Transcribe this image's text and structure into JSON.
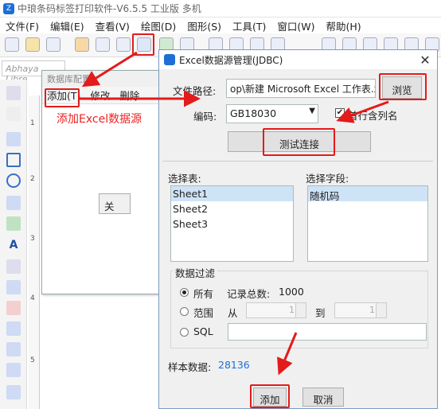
{
  "app": {
    "title": "中琅条码标签打印软件-V6.5.5 工业版 多机",
    "font_name": "Abhaya Libre"
  },
  "menu": [
    "文件(F)",
    "编辑(E)",
    "查看(V)",
    "绘图(D)",
    "图形(S)",
    "工具(T)",
    "窗口(W)",
    "帮助(H)"
  ],
  "ruler": [
    "1",
    "2",
    "3",
    "4",
    "5"
  ],
  "ds_manager": {
    "title": "数据库配置",
    "menu": {
      "add": "添加(T)",
      "edit": "修改",
      "delete": "删除"
    },
    "annotation": "添加Excel数据源",
    "close_label": "关"
  },
  "dialog": {
    "title": "Excel数据源管理(JDBC)",
    "file_path_label": "文件路径:",
    "file_path_value": "op\\新建 Microsoft Excel 工作表.xls",
    "browse": "浏览",
    "encoding_label": "编码:",
    "encoding_value": "GB18030",
    "first_row_label": "首行含列名",
    "test_connection": "测试连接",
    "select_table_label": "选择表:",
    "tables": [
      "Sheet1",
      "Sheet2",
      "Sheet3"
    ],
    "select_field_label": "选择字段:",
    "fields": [
      "随机码"
    ],
    "filter_title": "数据过滤",
    "filter_all": "所有",
    "total_label": "记录总数:",
    "total_value": "1000",
    "filter_range": "范围",
    "from": "从",
    "to": "到",
    "from_value": "1",
    "to_value": "1",
    "filter_sql": "SQL",
    "sample_label": "样本数据:",
    "sample_value": "28136",
    "add": "添加",
    "cancel": "取消"
  },
  "colors": {
    "highlight": "#e31b1b",
    "accent": "#1d6fd6"
  }
}
